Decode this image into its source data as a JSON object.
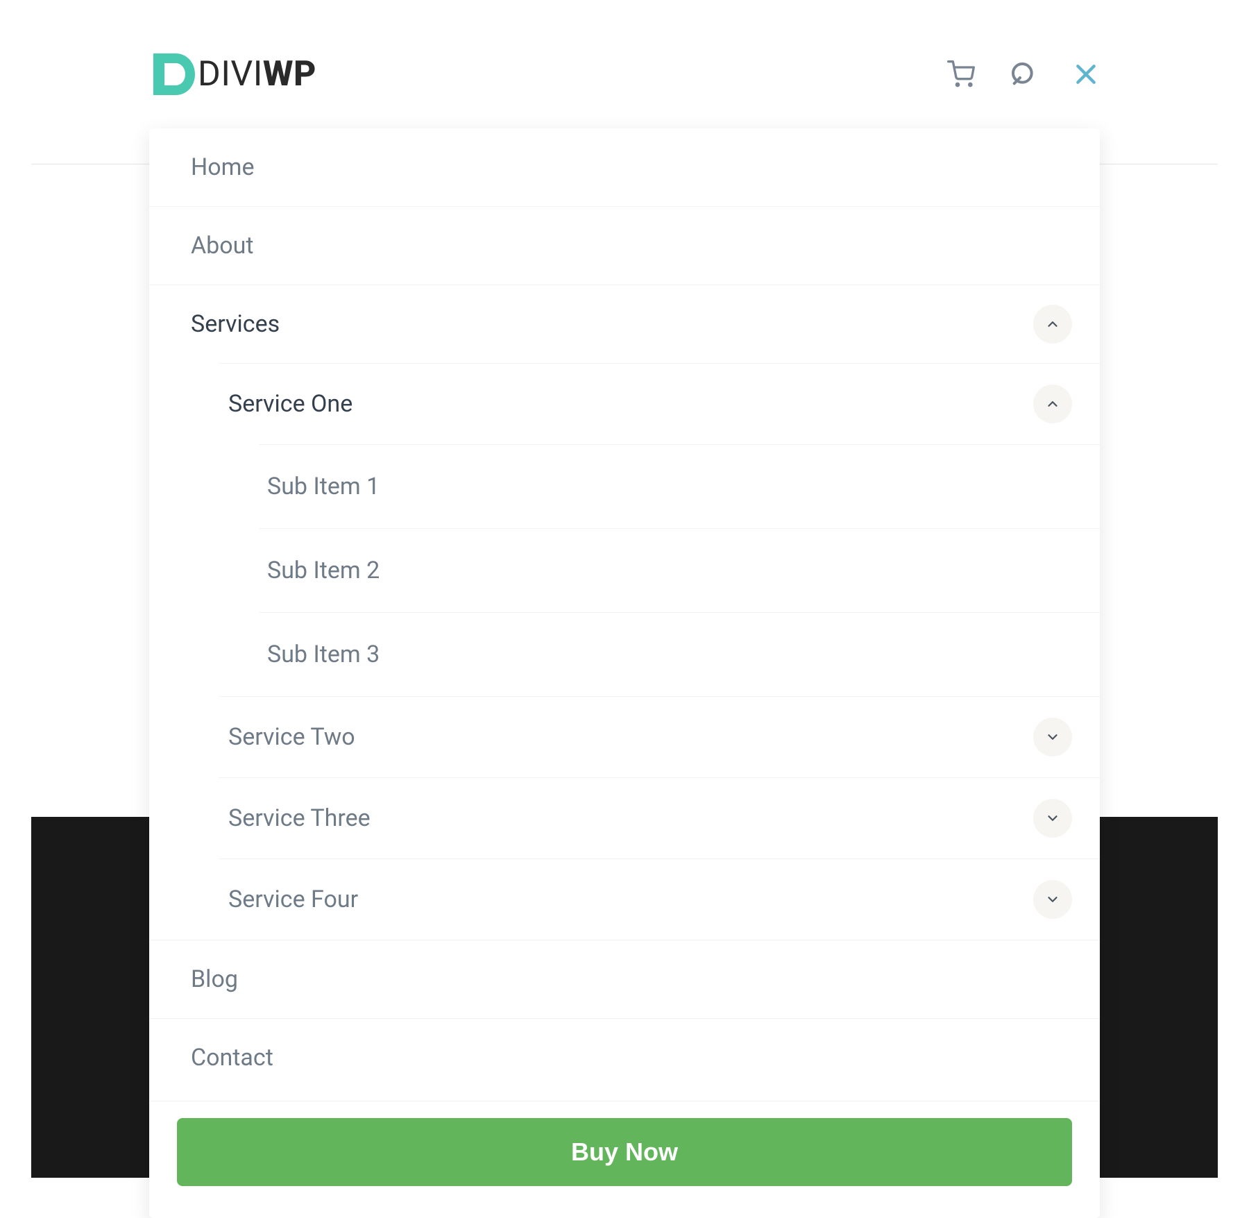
{
  "logo": {
    "prefix": "DIVI",
    "suffix": "WP"
  },
  "colors": {
    "brand_mark": "#48c9b0",
    "accent_close": "#5fb4cf",
    "cta_bg": "#62b55a"
  },
  "menu": {
    "items": [
      {
        "label": "Home"
      },
      {
        "label": "About"
      },
      {
        "label": "Services",
        "expanded": true,
        "children": [
          {
            "label": "Service One",
            "expanded": true,
            "children": [
              {
                "label": "Sub Item 1"
              },
              {
                "label": "Sub Item 2"
              },
              {
                "label": "Sub Item 3"
              }
            ]
          },
          {
            "label": "Service Two",
            "expanded": false,
            "children": []
          },
          {
            "label": "Service Three",
            "expanded": false,
            "children": []
          },
          {
            "label": "Service Four",
            "expanded": false,
            "children": []
          }
        ]
      },
      {
        "label": "Blog"
      },
      {
        "label": "Contact"
      }
    ],
    "cta_label": "Buy Now"
  }
}
